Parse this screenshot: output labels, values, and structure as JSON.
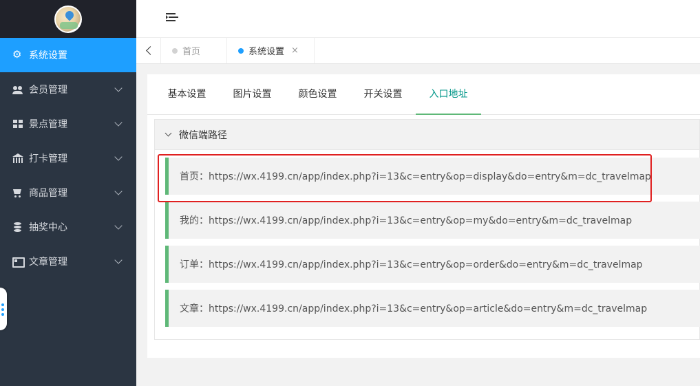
{
  "sidebar": {
    "items": [
      {
        "label": "系统设置",
        "icon": "gear-icon",
        "active": true
      },
      {
        "label": "会员管理",
        "icon": "users-icon"
      },
      {
        "label": "景点管理",
        "icon": "grid-icon"
      },
      {
        "label": "打卡管理",
        "icon": "bank-icon"
      },
      {
        "label": "商品管理",
        "icon": "cart-icon"
      },
      {
        "label": "抽奖中心",
        "icon": "database-icon"
      },
      {
        "label": "文章管理",
        "icon": "news-icon"
      }
    ]
  },
  "tabs": {
    "items": [
      {
        "label": "首页",
        "active": false
      },
      {
        "label": "系统设置",
        "active": true,
        "close": "×"
      }
    ]
  },
  "settings_tabs": [
    "基本设置",
    "图片设置",
    "颜色设置",
    "开关设置",
    "入口地址"
  ],
  "active_settings_tab": "入口地址",
  "panel": {
    "title": "微信端路径",
    "links": [
      "首页：https://wx.4199.cn/app/index.php?i=13&c=entry&op=display&do=entry&m=dc_travelmap",
      "我的：https://wx.4199.cn/app/index.php?i=13&c=entry&op=my&do=entry&m=dc_travelmap",
      "订单：https://wx.4199.cn/app/index.php?i=13&c=entry&op=order&do=entry&m=dc_travelmap",
      "文章：https://wx.4199.cn/app/index.php?i=13&c=entry&op=article&do=entry&m=dc_travelmap"
    ]
  },
  "colors": {
    "sidebar_bg": "#2b3542",
    "active_blue": "#1e9fff",
    "accent_green": "#5fb878",
    "highlight_red": "#e02020"
  }
}
